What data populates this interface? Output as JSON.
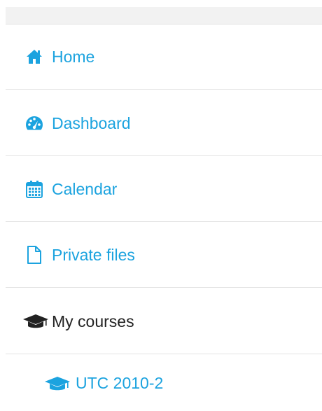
{
  "nav": {
    "items": [
      {
        "label": "Home",
        "icon": "home-icon",
        "link": true
      },
      {
        "label": "Dashboard",
        "icon": "dashboard-icon",
        "link": true
      },
      {
        "label": "Calendar",
        "icon": "calendar-icon",
        "link": true
      },
      {
        "label": "Private files",
        "icon": "file-icon",
        "link": true
      },
      {
        "label": "My courses",
        "icon": "graduation-cap-icon",
        "link": false
      },
      {
        "label": "UTC 2010-2",
        "icon": "graduation-cap-icon",
        "link": true
      }
    ]
  },
  "colors": {
    "link": "#1ca3df",
    "text_dark": "#222222",
    "divider": "#e3e3e3",
    "top_strip": "#f2f2f2"
  }
}
